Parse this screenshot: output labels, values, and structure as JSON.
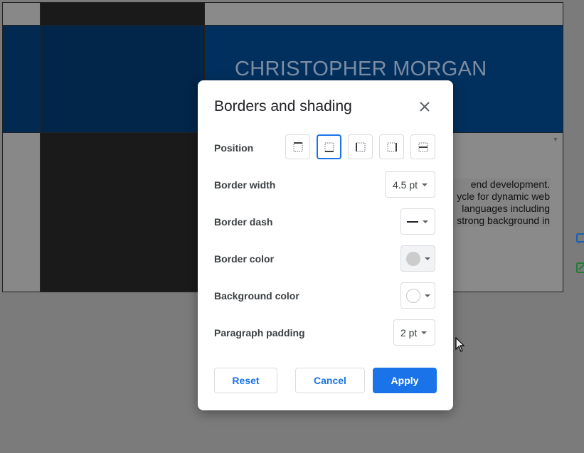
{
  "document": {
    "name_heading": "CHRISTOPHER MORGAN",
    "body_lines": [
      "end development.",
      "ycle for dynamic web",
      "languages including",
      "strong background in"
    ]
  },
  "dialog": {
    "title": "Borders and shading",
    "position_label": "Position",
    "position_options": [
      "top-border",
      "bottom-border",
      "left-border",
      "right-border",
      "between-border"
    ],
    "position_selected": "bottom-border",
    "border_width_label": "Border width",
    "border_width_value": "4.5 pt",
    "border_dash_label": "Border dash",
    "border_dash_value": "solid-line",
    "border_color_label": "Border color",
    "border_color_value": "#cccccc",
    "background_color_label": "Background color",
    "background_color_value": "#ffffff",
    "paragraph_padding_label": "Paragraph padding",
    "paragraph_padding_value": "2 pt",
    "reset_label": "Reset",
    "cancel_label": "Cancel",
    "apply_label": "Apply"
  },
  "colors": {
    "accent": "#1a73e8",
    "header_band": "#02305e"
  }
}
